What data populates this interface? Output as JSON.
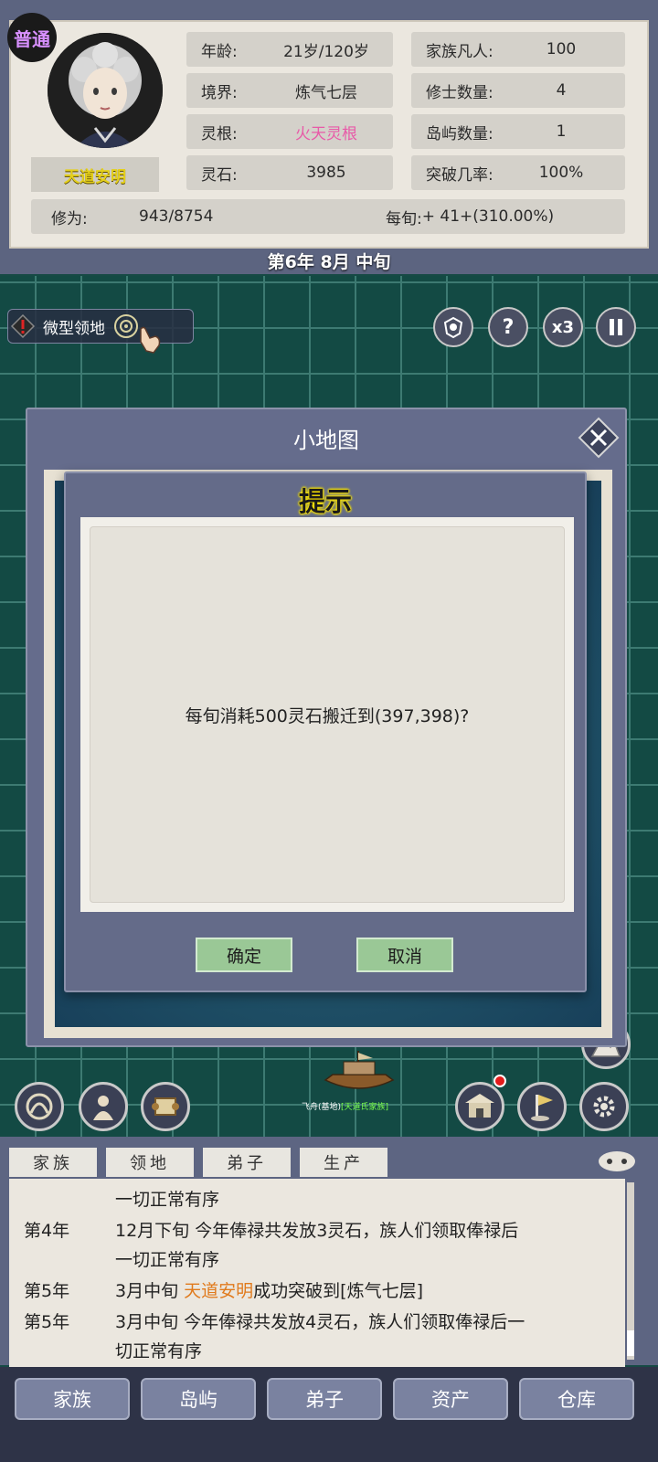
{
  "profile": {
    "rank_badge": "普通",
    "name": "天道安明",
    "stats_left": [
      {
        "key": "年龄:",
        "value": "21岁/120岁"
      },
      {
        "key": "境界:",
        "value": "炼气七层"
      },
      {
        "key": "灵根:",
        "value": "火天灵根"
      },
      {
        "key": "灵石:",
        "value": "3985"
      }
    ],
    "stats_right": [
      {
        "key": "家族凡人:",
        "value": "100"
      },
      {
        "key": "修士数量:",
        "value": "4"
      },
      {
        "key": "岛屿数量:",
        "value": "1"
      },
      {
        "key": "突破几率:",
        "value": "100%"
      }
    ],
    "cultivation_label": "修为:",
    "cultivation_value": "943/8754",
    "per_period_label": "每旬:",
    "per_period_value": "+ 41+(310.00%)",
    "colors": {
      "spirit_root": "#e85aa8",
      "name": "#e5d01b"
    }
  },
  "date": "第6年 8月 中旬",
  "map": {
    "territory_label": "微型领地",
    "speed_label": "x3",
    "ship_label": "飞舟(基地)",
    "ship_clan": "[天道氏家族]"
  },
  "minimap": {
    "title": "小地图"
  },
  "confirm": {
    "title": "提示",
    "message": "每旬消耗500灵石搬迁到(397,398)?",
    "ok_label": "确定",
    "cancel_label": "取消"
  },
  "log": {
    "tabs": [
      "家族",
      "领地",
      "弟子",
      "生产"
    ],
    "rows": [
      {
        "year": "",
        "msg": "一切正常有序"
      },
      {
        "year": "第4年",
        "msg": "12月下旬 今年俸禄共发放3灵石，族人们领取俸禄后"
      },
      {
        "year": "",
        "msg": "一切正常有序"
      },
      {
        "year": "第5年",
        "prefix": "3月中旬 ",
        "name": "天道安明",
        "suffix": "成功突破到[炼气七层]"
      },
      {
        "year": "第5年",
        "msg": "3月中旬 今年俸禄共发放4灵石，族人们领取俸禄后一"
      },
      {
        "year": "",
        "msg": "切正常有序"
      }
    ]
  },
  "nav": [
    "家族",
    "岛屿",
    "弟子",
    "资产",
    "仓库"
  ]
}
